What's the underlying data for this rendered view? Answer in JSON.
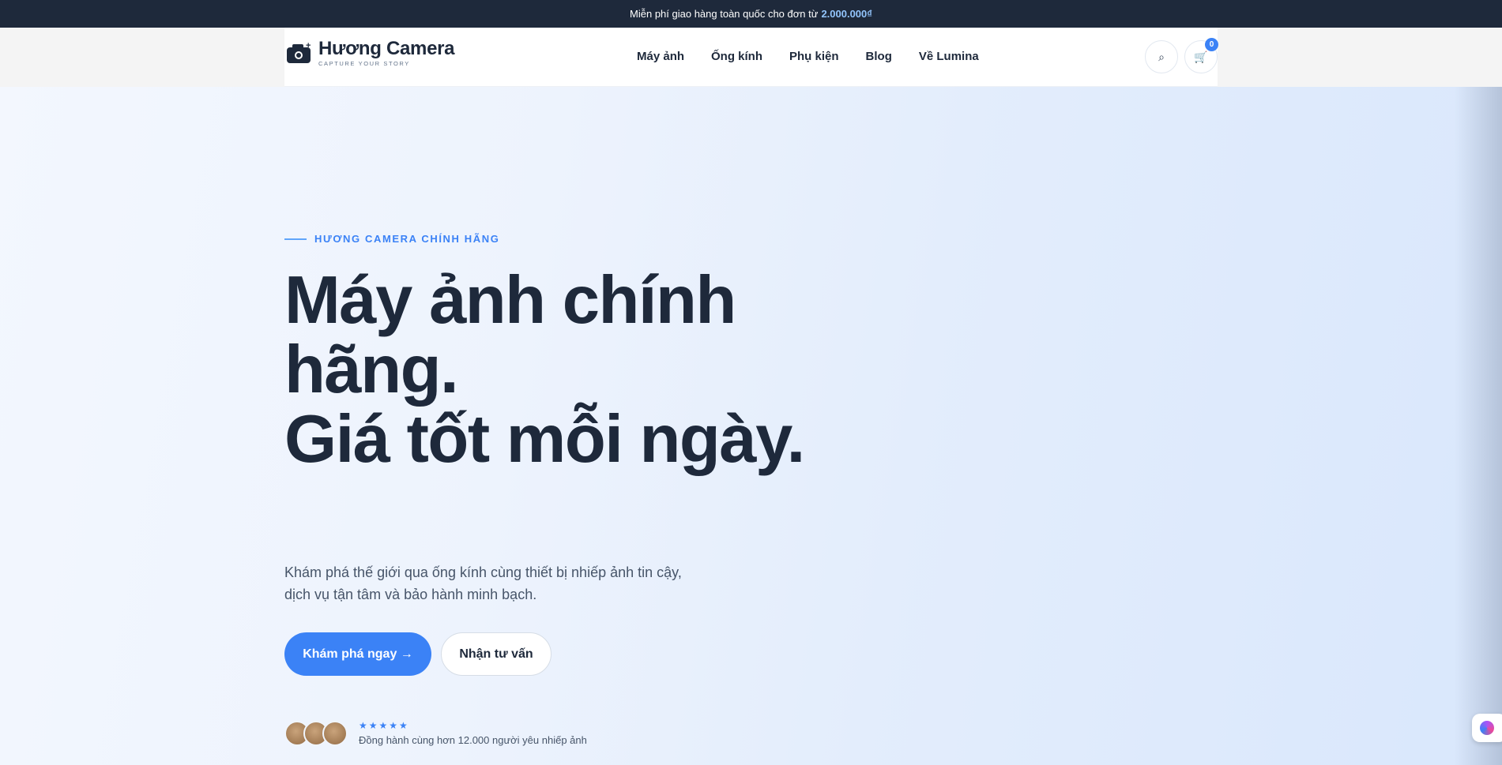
{
  "announcement": {
    "text": "Miễn phí giao hàng toàn quốc cho đơn từ",
    "amount": "2.000.000₫"
  },
  "brand": {
    "name": "Hương Camera",
    "tagline": "CAPTURE YOUR STORY"
  },
  "nav": {
    "items": [
      "Máy ảnh",
      "Ống kính",
      "Phụ kiện",
      "Blog",
      "Về Lumina"
    ]
  },
  "header_actions": {
    "search_icon": "⌕",
    "cart_icon": "🛒",
    "cart_count": "0"
  },
  "hero": {
    "eyebrow": "HƯƠNG CAMERA CHÍNH HÃNG",
    "headline_line1": "Máy ảnh chính hãng.",
    "headline_line2": "Giá tốt mỗi ngày.",
    "description": "Khám phá thế giới qua ống kính cùng thiết bị nhiếp ảnh tin cậy, dịch vụ tận tâm và bảo hành minh bạch.",
    "primary_cta": "Khám phá ngay →",
    "secondary_cta": "Nhận tư vấn",
    "stars": "★★★★★",
    "social_proof": "Đồng hành cùng hơn 12.000 người yêu nhiếp ảnh"
  },
  "colors": {
    "accent": "#3b82f6",
    "dark": "#1e293b",
    "topbar_bg": "#1e293b"
  }
}
